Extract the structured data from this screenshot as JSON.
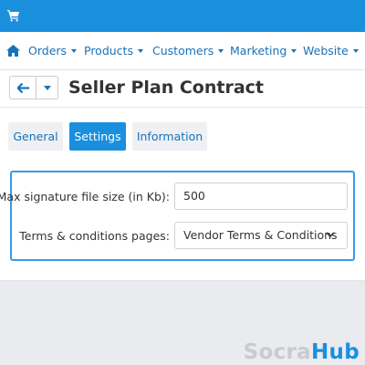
{
  "topbar": {
    "cart_icon": "cart-icon",
    "color": "#1a8fde"
  },
  "nav": {
    "home_icon": "home-icon",
    "items": [
      {
        "label": "Orders"
      },
      {
        "label": "Products"
      },
      {
        "label": "Customers"
      },
      {
        "label": "Marketing"
      },
      {
        "label": "Website"
      }
    ]
  },
  "header": {
    "back_icon": "arrow-left-icon",
    "dropdown_icon": "caret-down-icon",
    "title": "Seller Plan Contract"
  },
  "tabs": [
    {
      "label": "General",
      "active": false
    },
    {
      "label": "Settings",
      "active": true
    },
    {
      "label": "Information",
      "active": false
    }
  ],
  "form": {
    "max_signature_label": "Max signature file size (in Kb):",
    "max_signature_value": "500",
    "terms_label": "Terms & conditions pages:",
    "terms_value": "Vendor Terms & Conditions"
  },
  "watermark": {
    "part1": "Socra",
    "part2": "Hub"
  },
  "colors": {
    "accent": "#1a8fde",
    "link": "#1673b9",
    "highlight_border": "#3a9ae8"
  }
}
